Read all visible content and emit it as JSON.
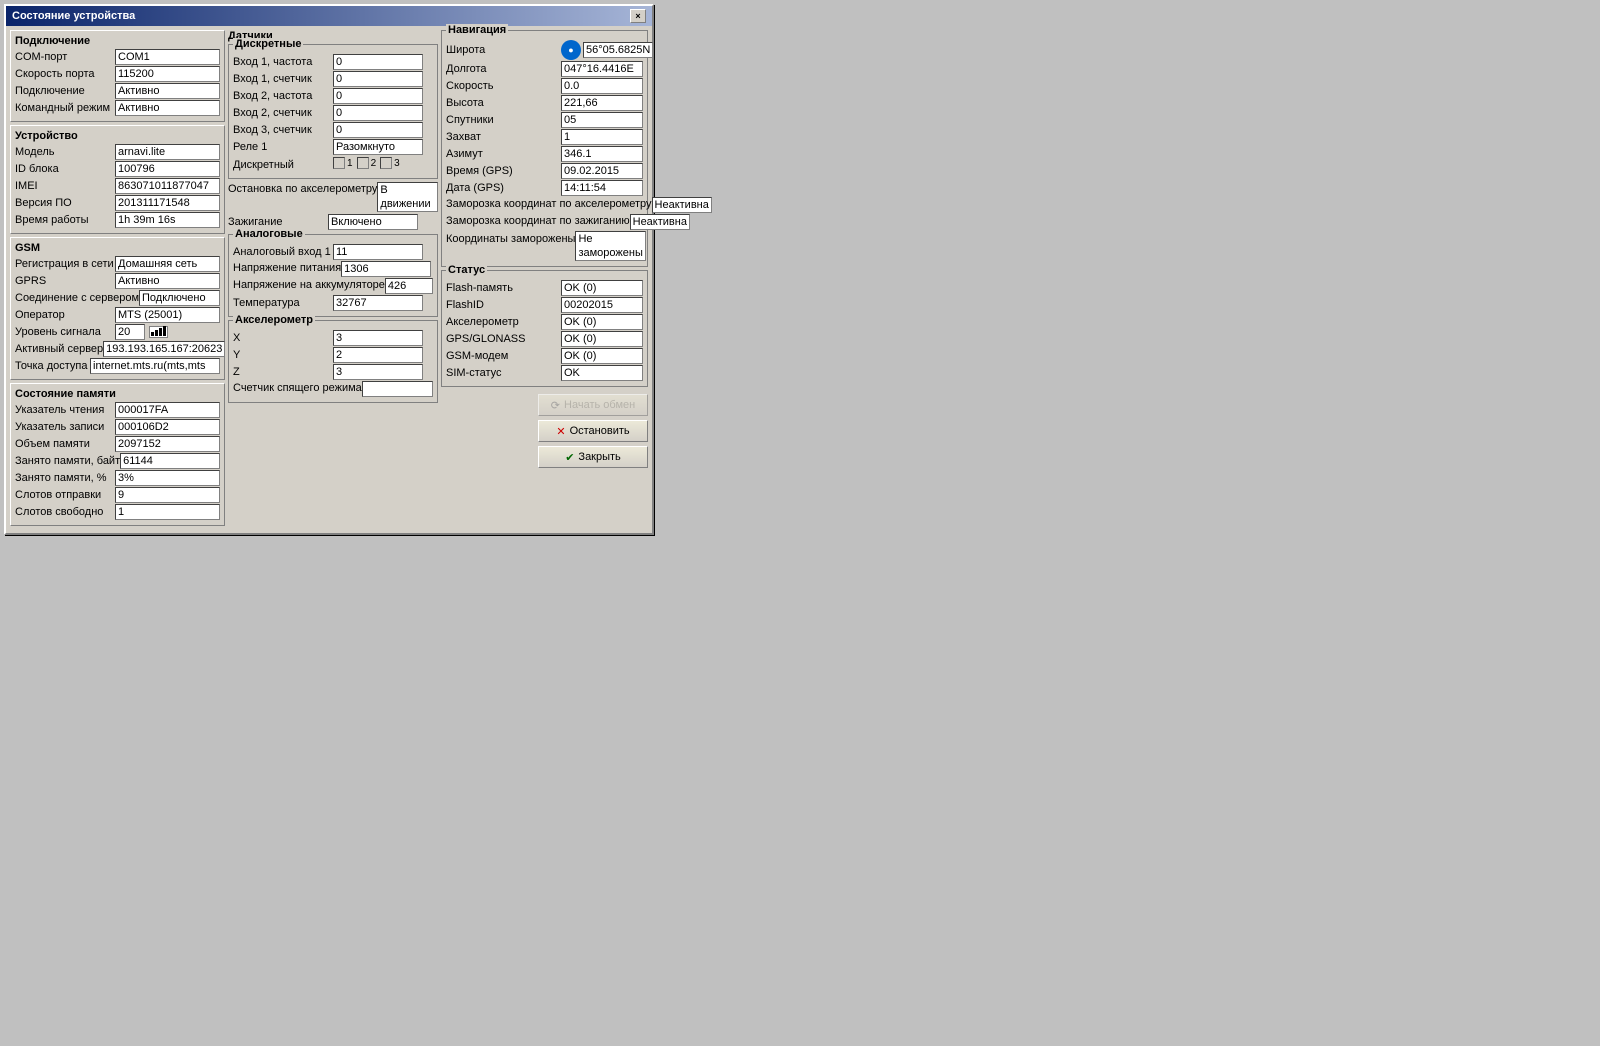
{
  "window": {
    "title": "Состояние устройства",
    "close_label": "×"
  },
  "left": {
    "connection_title": "Подключение",
    "com_port_label": "COM-порт",
    "com_port_value": "COM1",
    "port_speed_label": "Скорость порта",
    "port_speed_value": "115200",
    "connection_label": "Подключение",
    "connection_value": "Активно",
    "cmd_mode_label": "Командный режим",
    "cmd_mode_value": "Активно",
    "device_title": "Устройство",
    "model_label": "Модель",
    "model_value": "arnavi.lite",
    "block_id_label": "ID блока",
    "block_id_value": "100796",
    "imei_label": "IMEI",
    "imei_value": "863071011877047",
    "fw_version_label": "Версия ПО",
    "fw_version_value": "201311171548",
    "uptime_label": "Время работы",
    "uptime_value": "1h 39m 16s",
    "gsm_title": "GSM",
    "net_reg_label": "Регистрация в сети",
    "net_reg_value": "Домашняя сеть",
    "gprs_label": "GPRS",
    "gprs_value": "Активно",
    "server_conn_label": "Соединение с сервером",
    "server_conn_value": "Подключено",
    "operator_label": "Оператор",
    "operator_value": "MTS (25001)",
    "signal_label": "Уровень сигнала",
    "signal_value": "20",
    "active_server_label": "Активный сервер",
    "active_server_value": "193.193.165.167:20623",
    "access_point_label": "Точка доступа",
    "access_point_value": "internet.mts.ru(mts,mts",
    "memory_title": "Состояние памяти",
    "read_ptr_label": "Указатель чтения",
    "read_ptr_value": "000017FA",
    "write_ptr_label": "Указатель записи",
    "write_ptr_value": "000106D2",
    "mem_size_label": "Объем памяти",
    "mem_size_value": "2097152",
    "mem_used_bytes_label": "Занято памяти, байт",
    "mem_used_bytes_value": "61144",
    "mem_used_pct_label": "Занято памяти, %",
    "mem_used_pct_value": "3%",
    "send_slots_label": "Слотов отправки",
    "send_slots_value": "9",
    "free_slots_label": "Слотов свободно",
    "free_slots_value": "1"
  },
  "middle": {
    "sensors_title": "Датчики",
    "discrete_title": "Дискретные",
    "in1_freq_label": "Вход 1, частота",
    "in1_freq_value": "0",
    "in1_cnt_label": "Вход 1, счетчик",
    "in1_cnt_value": "0",
    "in2_freq_label": "Вход 2, частота",
    "in2_freq_value": "0",
    "in2_cnt_label": "Вход 2, счетчик",
    "in2_cnt_value": "0",
    "in3_cnt_label": "Вход 3, счетчик",
    "in3_cnt_value": "0",
    "relay1_label": "Реле 1",
    "relay1_value": "Разомкнуто",
    "discrete_label": "Дискретный",
    "cb1_label": "1",
    "cb2_label": "2",
    "cb3_label": "3",
    "accel_stop_label": "Остановка по акселерометру",
    "accel_stop_value": "В движении",
    "ignition_label": "Зажигание",
    "ignition_value": "Включено",
    "analog_title": "Аналоговые",
    "analog_in1_label": "Аналоговый вход 1",
    "analog_in1_value": "11",
    "power_voltage_label": "Напряжение питания",
    "power_voltage_value": "1306",
    "battery_voltage_label": "Напряжение на аккумуляторе",
    "battery_voltage_value": "426",
    "temperature_label": "Температура",
    "temperature_value": "32767",
    "accel_title": "Акселерометр",
    "accel_x_label": "X",
    "accel_x_value": "3",
    "accel_y_label": "Y",
    "accel_y_value": "2",
    "accel_z_label": "Z",
    "accel_z_value": "3",
    "sleep_cnt_label": "Счетчик спящего режима",
    "sleep_cnt_value": ""
  },
  "right": {
    "nav_title": "Навигация",
    "latitude_label": "Широта",
    "latitude_value": "56°05.6825N",
    "longitude_label": "Долгота",
    "longitude_value": "047°16.4416E",
    "speed_label": "Скорость",
    "speed_value": "0.0",
    "altitude_label": "Высота",
    "altitude_value": "221,66",
    "satellites_label": "Спутники",
    "satellites_value": "05",
    "fix_label": "Захват",
    "fix_value": "1",
    "azimuth_label": "Азимут",
    "azimuth_value": "346.1",
    "gps_time_label": "Время (GPS)",
    "gps_time_value": "09.02.2015",
    "gps_date_label": "Дата (GPS)",
    "gps_date_value": "14:11:54",
    "accel_freeze_label": "Заморозка координат по акселерометру",
    "accel_freeze_value": "Неактивна",
    "ignition_freeze_label": "Заморозка координат по зажиганию",
    "ignition_freeze_value": "Неактивна",
    "coords_frozen_label": "Координаты заморожены",
    "coords_frozen_value": "Не заморожены",
    "status_title": "Статус",
    "flash_label": "Flash-память",
    "flash_value": "OK (0)",
    "flashid_label": "FlashID",
    "flashid_value": "00202015",
    "accel_status_label": "Акселерометр",
    "accel_status_value": "OK (0)",
    "gps_glonass_label": "GPS/GLONASS",
    "gps_glonass_value": "OK (0)",
    "gsm_modem_label": "GSM-модем",
    "gsm_modem_value": "OK (0)",
    "sim_label": "SIM-статус",
    "sim_value": "OK",
    "btn_start_label": "Начать обмен",
    "btn_stop_label": "Остановить",
    "btn_close_label": "Закрыть"
  }
}
